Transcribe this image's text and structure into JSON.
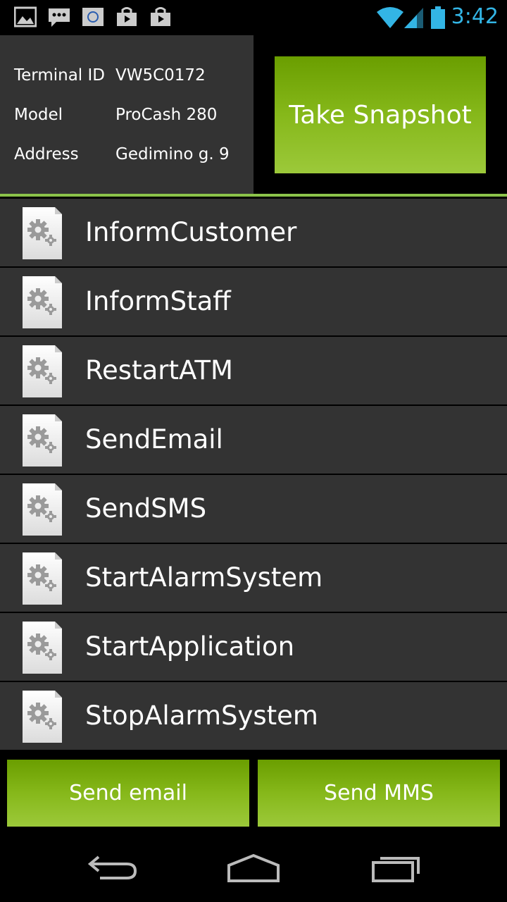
{
  "status_bar": {
    "time": "3:42",
    "notification_icons": [
      "gallery-icon",
      "chat-icon",
      "app-icon",
      "store-icon",
      "store-icon"
    ],
    "accent_color": "#33b5e5"
  },
  "terminal": {
    "rows": [
      {
        "label": "Terminal ID",
        "value": "VW5C0172"
      },
      {
        "label": "Model",
        "value": "ProCash 280"
      },
      {
        "label": "Address",
        "value": "Gedimino g. 9"
      }
    ]
  },
  "snapshot_button": "Take Snapshot",
  "commands": [
    "InformCustomer",
    "InformStaff",
    "RestartATM",
    "SendEmail",
    "SendSMS",
    "StartAlarmSystem",
    "StartApplication",
    "StopAlarmSystem"
  ],
  "actions": {
    "send_email": "Send email",
    "send_mms": "Send MMS"
  },
  "colors": {
    "button_green": "#86b81a",
    "panel": "#333333",
    "divider_green": "#8bc34a"
  }
}
